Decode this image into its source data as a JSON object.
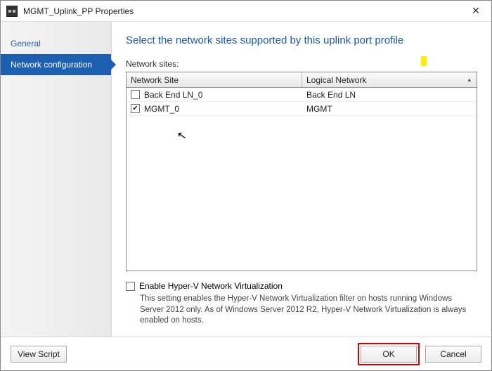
{
  "window": {
    "title": "MGMT_Uplink_PP Properties"
  },
  "sidebar": {
    "items": [
      {
        "label": "General",
        "selected": false
      },
      {
        "label": "Network configuration",
        "selected": true
      }
    ]
  },
  "main": {
    "heading": "Select the network sites supported by this uplink port profile",
    "grid_label": "Network sites:",
    "columns": {
      "site": "Network Site",
      "logical": "Logical Network"
    },
    "rows": [
      {
        "site": "Back End LN_0",
        "logical": "Back End LN",
        "checked": false
      },
      {
        "site": "MGMT_0",
        "logical": "MGMT",
        "checked": true
      }
    ],
    "hv_checkbox_label": "Enable Hyper-V Network Virtualization",
    "hv_checkbox_checked": false,
    "hv_desc": "This setting enables the Hyper-V Network Virtualization filter on hosts running Windows Server 2012 only. As of Windows Server 2012 R2, Hyper-V Network Virtualization is always enabled on hosts."
  },
  "footer": {
    "view_script": "View Script",
    "ok": "OK",
    "cancel": "Cancel"
  }
}
